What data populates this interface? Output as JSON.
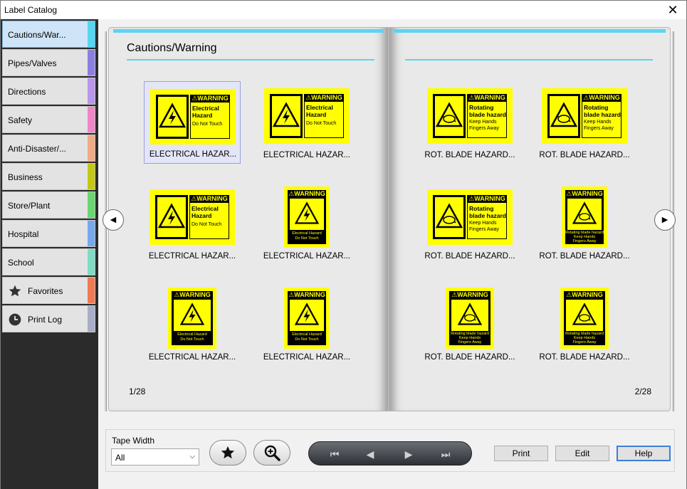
{
  "window": {
    "title": "Label Catalog",
    "close_glyph": "✕"
  },
  "sidebar": {
    "items": [
      {
        "label": "Cautions/War...",
        "color": "#56d7ef",
        "selected": true
      },
      {
        "label": "Pipes/Valves",
        "color": "#8b7fe0"
      },
      {
        "label": "Directions",
        "color": "#b896ea"
      },
      {
        "label": "Safety",
        "color": "#ee86c8"
      },
      {
        "label": "Anti-Disaster/...",
        "color": "#f2aa86"
      },
      {
        "label": "Business",
        "color": "#c2c814"
      },
      {
        "label": "Store/Plant",
        "color": "#6ad66e"
      },
      {
        "label": "Hospital",
        "color": "#76a8ee"
      },
      {
        "label": "School",
        "color": "#7edcc4"
      },
      {
        "label": "Favorites",
        "color": "#f07a52",
        "icon": "star-icon"
      },
      {
        "label": "Print Log",
        "color": "#a8aec8",
        "icon": "clock-icon"
      }
    ]
  },
  "book": {
    "left_page": {
      "title": "Cautions/Warning",
      "page_number": "1/28",
      "items": [
        {
          "caption": "ELECTRICAL HAZAR...",
          "kind": "electrical",
          "layout": "h1"
        },
        {
          "caption": "ELECTRICAL HAZAR...",
          "kind": "electrical",
          "layout": "h2"
        },
        {
          "caption": "ELECTRICAL HAZAR...",
          "kind": "electrical",
          "layout": "h1"
        },
        {
          "caption": "ELECTRICAL HAZAR...",
          "kind": "electrical",
          "layout": "v1"
        },
        {
          "caption": "ELECTRICAL HAZAR...",
          "kind": "electrical",
          "layout": "v2"
        },
        {
          "caption": "ELECTRICAL HAZAR...",
          "kind": "electrical",
          "layout": "v1"
        }
      ]
    },
    "right_page": {
      "page_number": "2/28",
      "items": [
        {
          "caption": "ROT. BLADE HAZARD...",
          "kind": "blade",
          "layout": "h1"
        },
        {
          "caption": "ROT. BLADE HAZARD...",
          "kind": "blade",
          "layout": "h2"
        },
        {
          "caption": "ROT. BLADE HAZARD...",
          "kind": "blade",
          "layout": "h1"
        },
        {
          "caption": "ROT. BLADE HAZARD...",
          "kind": "blade",
          "layout": "v1"
        },
        {
          "caption": "ROT. BLADE HAZARD...",
          "kind": "blade",
          "layout": "v2"
        },
        {
          "caption": "ROT. BLADE HAZARD...",
          "kind": "blade",
          "layout": "v2"
        }
      ]
    },
    "label_text": {
      "warning": "⚠WARNING",
      "electrical": {
        "line1": "Electrical",
        "line2": "Hazard",
        "small": "Do Not Touch",
        "v_text": "Electrical Hazard",
        "v_small": "Do Not Touch"
      },
      "blade": {
        "line1": "Rotating",
        "line2": "blade hazard",
        "small1": "Keep Hands",
        "small2": "Fingers Away",
        "v_text": "Rotating blade hazard",
        "v_small1": "Keep Hands",
        "v_small2": "Fingers Away"
      }
    },
    "prev_glyph": "◀",
    "next_glyph": "▶"
  },
  "controls": {
    "tape_width_label": "Tape Width",
    "tape_width_value": "All",
    "dropdown_glyph": "⌵",
    "navbar": {
      "first": "⏮",
      "prev": "◀",
      "next": "▶",
      "last": "⏭"
    },
    "print_label": "Print",
    "edit_label": "Edit",
    "help_label": "Help"
  },
  "colors": {
    "accent": "#5cd3f2",
    "label_yellow": "#ffff00",
    "sidebar_bg": "#2b2b2b"
  }
}
